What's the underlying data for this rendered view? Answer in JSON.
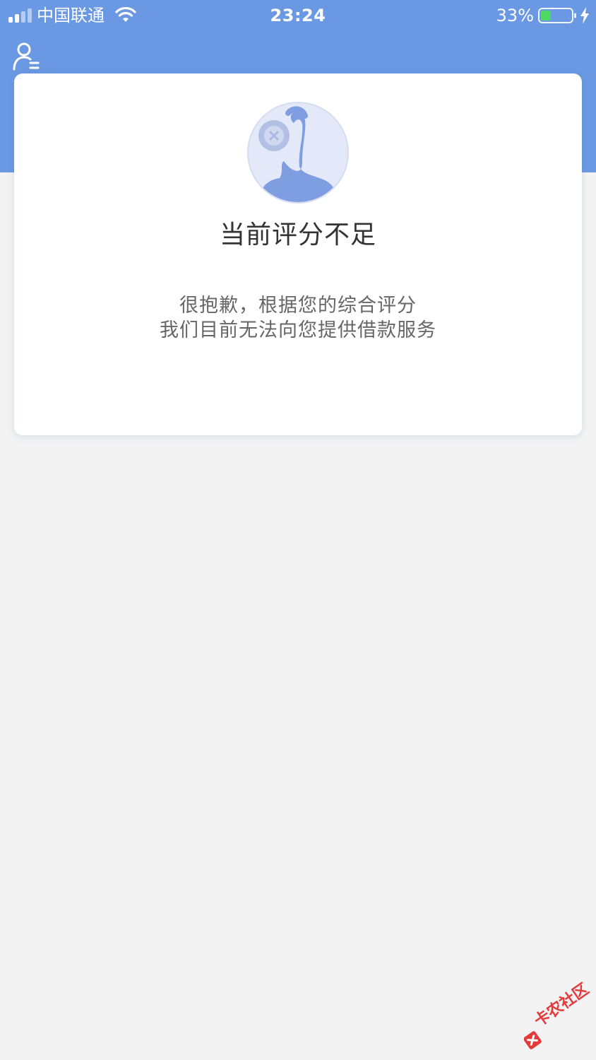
{
  "status_bar": {
    "carrier": "中国联通",
    "time": "23:24",
    "battery_percent": "33%",
    "battery_level": 0.33,
    "charging": true
  },
  "header": {
    "profile_icon": "user-menu-icon",
    "background_color": "#6b98e2"
  },
  "result_card": {
    "avatar_icon": "mascot-avatar-icon",
    "title": "当前评分不足",
    "message_line1": "很抱歉，根据您的综合评分",
    "message_line2": "我们目前无法向您提供借款服务"
  },
  "watermark": {
    "text": "卡农社区"
  },
  "colors": {
    "accent": "#6b98e2",
    "page_background": "#f3f3f4",
    "title_text": "#333333",
    "body_text": "#666666",
    "battery_fill": "#4cd964"
  }
}
